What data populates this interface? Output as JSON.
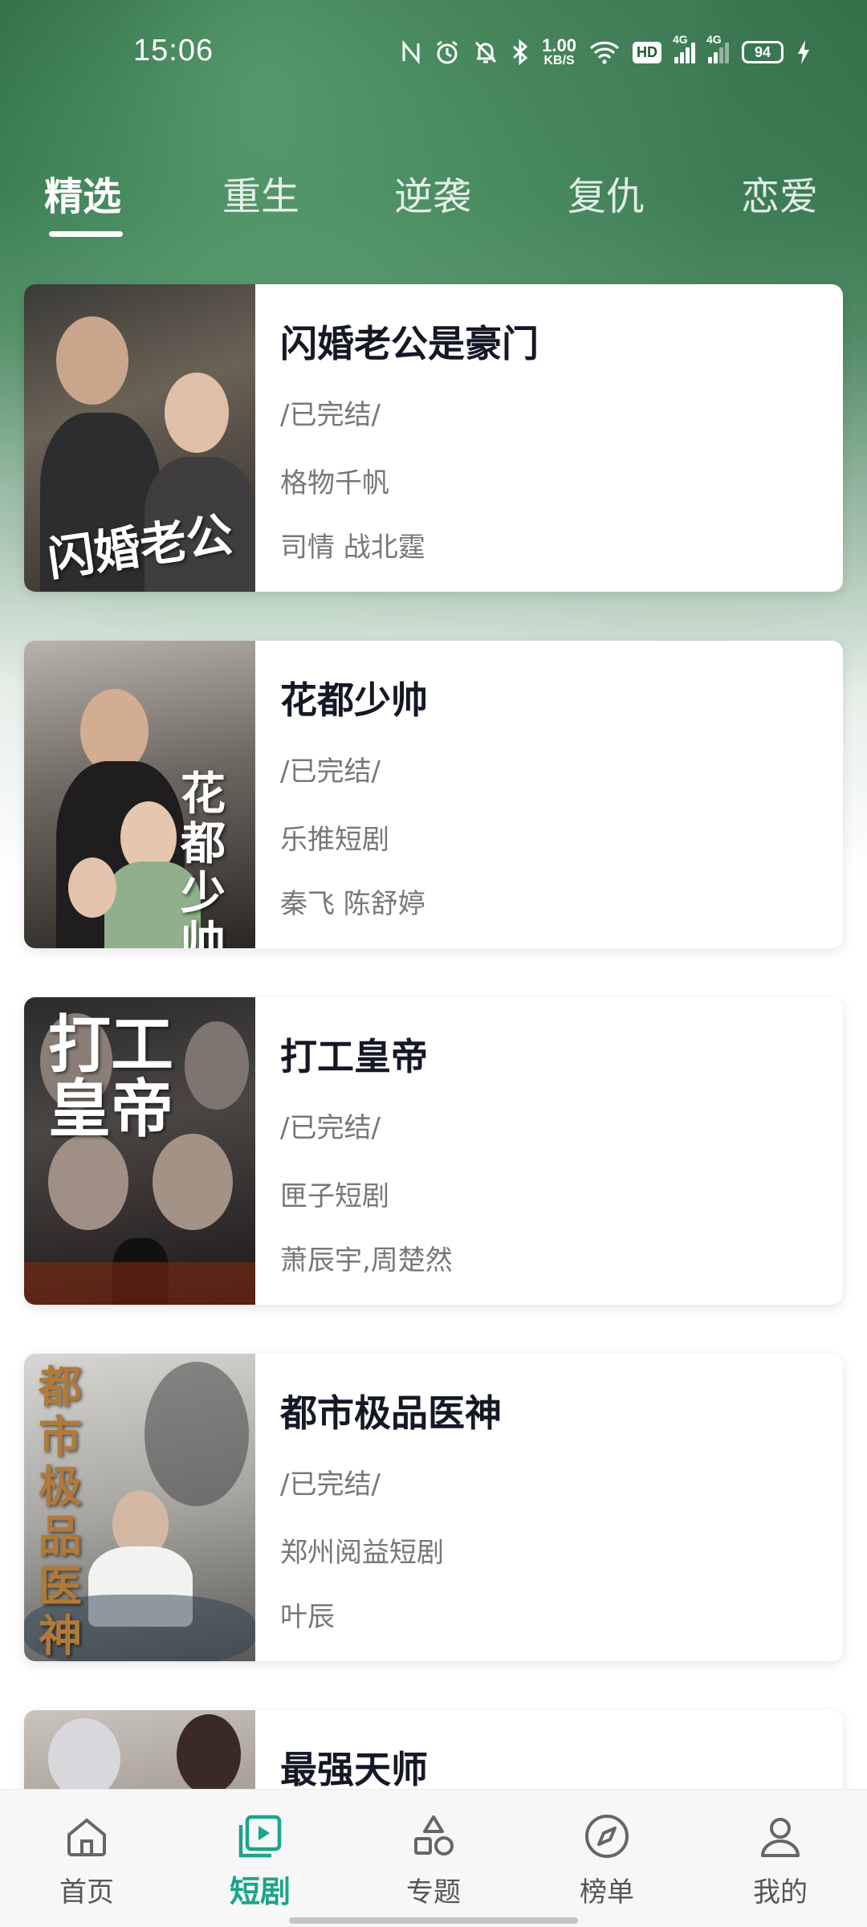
{
  "status_bar": {
    "time": "15:06",
    "net_speed_value": "1.00",
    "net_speed_unit": "KB/S",
    "hd_badge": "HD",
    "signal_1_label": "4G",
    "signal_2_label": "4G",
    "battery_level": "94"
  },
  "tabs": [
    {
      "label": "精选",
      "active": true
    },
    {
      "label": "重生",
      "active": false
    },
    {
      "label": "逆袭",
      "active": false
    },
    {
      "label": "复仇",
      "active": false
    },
    {
      "label": "恋爱",
      "active": false
    }
  ],
  "dramas": [
    {
      "title": "闪婚老公是豪门",
      "status": "/已完结/",
      "producer": "格物千帆",
      "cast": "司情 战北霆"
    },
    {
      "title": "花都少帅",
      "status": "/已完结/",
      "producer": "乐推短剧",
      "cast": "秦飞  陈舒婷"
    },
    {
      "title": "打工皇帝",
      "status": "/已完结/",
      "producer": "匣子短剧",
      "cast": "萧辰宇,周楚然"
    },
    {
      "title": "都市极品医神",
      "status": "/已完结/",
      "producer": "郑州阅益短剧",
      "cast": "叶辰"
    },
    {
      "title": "最强天师"
    }
  ],
  "bottom_nav": [
    {
      "label": "首页",
      "icon": "home-icon"
    },
    {
      "label": "短剧",
      "icon": "short-drama-icon",
      "active": true
    },
    {
      "label": "专题",
      "icon": "topics-icon"
    },
    {
      "label": "榜单",
      "icon": "compass-icon"
    },
    {
      "label": "我的",
      "icon": "profile-icon"
    }
  ],
  "colors": {
    "accent": "#1aa58a",
    "hero_green": "#2c6d45",
    "title_text": "#151826",
    "secondary_text": "#777777"
  }
}
